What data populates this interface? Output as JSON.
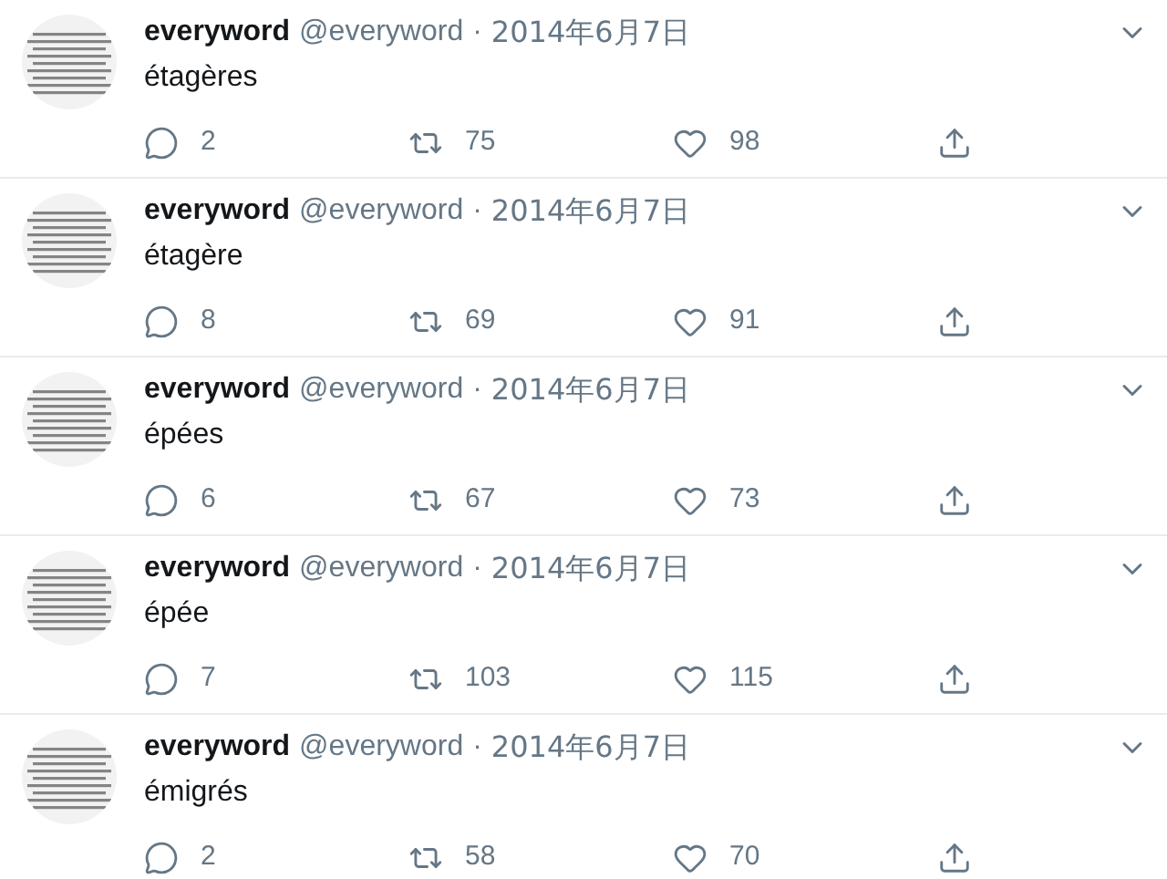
{
  "tweets": [
    {
      "name": "everyword",
      "handle": "@everyword",
      "separator": "·",
      "date": "2014年6月7日",
      "text": "étagères",
      "replies": "2",
      "retweets": "75",
      "likes": "98"
    },
    {
      "name": "everyword",
      "handle": "@everyword",
      "separator": "·",
      "date": "2014年6月7日",
      "text": "étagère",
      "replies": "8",
      "retweets": "69",
      "likes": "91"
    },
    {
      "name": "everyword",
      "handle": "@everyword",
      "separator": "·",
      "date": "2014年6月7日",
      "text": "épées",
      "replies": "6",
      "retweets": "67",
      "likes": "73"
    },
    {
      "name": "everyword",
      "handle": "@everyword",
      "separator": "·",
      "date": "2014年6月7日",
      "text": "épée",
      "replies": "7",
      "retweets": "103",
      "likes": "115"
    },
    {
      "name": "everyword",
      "handle": "@everyword",
      "separator": "·",
      "date": "2014年6月7日",
      "text": "émigrés",
      "replies": "2",
      "retweets": "58",
      "likes": "70"
    }
  ]
}
